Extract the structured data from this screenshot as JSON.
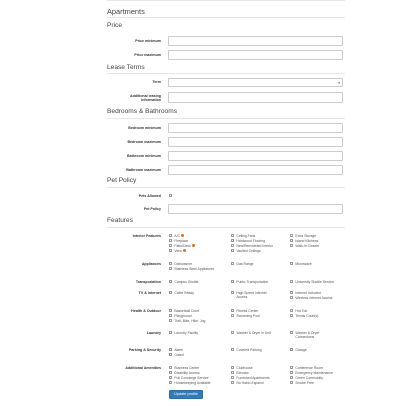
{
  "sections": {
    "apartments": "Apartments",
    "price": "Price",
    "lease_terms": "Lease Terms",
    "bedrooms_bathrooms": "Bedrooms & Bathrooms",
    "pet_policy": "Pet Policy",
    "features": "Features"
  },
  "price": {
    "minimum_label": "Price minimum",
    "maximum_label": "Price maximum"
  },
  "lease": {
    "term_label": "Term",
    "additional_label_1": "Additional leasing",
    "additional_label_2": "information"
  },
  "rooms": {
    "bedroom_min_label": "Bedroom minimum",
    "bedroom_max_label": "Bedroom maximum",
    "bathroom_min_label": "Bathroom minimum",
    "bathroom_max_label": "Bathroom maximum"
  },
  "pets": {
    "allowed_label": "Pets Allowed",
    "policy_label": "Pet Policy"
  },
  "features": {
    "groups": {
      "interior": "Interior Features",
      "appliances": "Appliances",
      "transportation": "Transportation",
      "tv": "TV & Internet",
      "health": "Health & Outdoor",
      "laundry": "Laundry",
      "parking": "Parking & Security",
      "additional": "Additional Amenities"
    },
    "interior": {
      "c1": [
        "A/C",
        "Fireplace",
        "Patio/Deck",
        "View"
      ],
      "c2": [
        "Ceiling Fans",
        "Hardwood Flooring",
        "New/Remodeled Interior",
        "Vaulted Ceilings"
      ],
      "c3": [
        "Extra Storage",
        "Island Kitchens",
        "Walk-In Closets"
      ]
    },
    "appliances": {
      "c1": [
        "Dishwasher",
        "Stainless Steel Appliances"
      ],
      "c2": [
        "Gas Range"
      ],
      "c3": [
        "Microwave"
      ]
    },
    "transportation": {
      "c1": [
        "Campus Shuttle"
      ],
      "c2": [
        "Public Transportation"
      ],
      "c3": [
        "University Shuttle Service"
      ]
    },
    "tv": {
      "c1": [
        "Cable Ready"
      ],
      "c2_1": "High Speed Internet",
      "c2_2": "Access",
      "c3": [
        "Internet Included",
        "Wireless Internet Access"
      ]
    },
    "health": {
      "c1": [
        "Basketball Court",
        "Playground",
        "Trail, Bike, Hike, Jog"
      ],
      "c2": [
        "Fitness Center",
        "Swimming Pool"
      ],
      "c3": [
        "Hot Tub",
        "Tennis Court(s)"
      ]
    },
    "laundry": {
      "c1": [
        "Laundry Facility"
      ],
      "c2": [
        "Washer & Dryer in Unit"
      ],
      "c3_1": "Washer & Dryer",
      "c3_2": "Connections"
    },
    "parking": {
      "c1": [
        "Alarm",
        "Gated"
      ],
      "c2": [
        "Covered Parking"
      ],
      "c3": [
        "Garage"
      ]
    },
    "additional": {
      "c1": [
        "Business Center",
        "Disability Access",
        "Full Concierge Service",
        "Housekeeping Available"
      ],
      "c2": [
        "Clubhouse",
        "Elevator",
        "Furnished Apartments",
        "No Hablo Espanol"
      ],
      "c3": [
        "Conference Room",
        "Emergency Maintenance",
        "Green Community",
        "Smoke Free"
      ]
    }
  },
  "submit_label": "Update profile",
  "colors": {
    "primary": "#337ab7",
    "info_icon": "#e2711d"
  }
}
